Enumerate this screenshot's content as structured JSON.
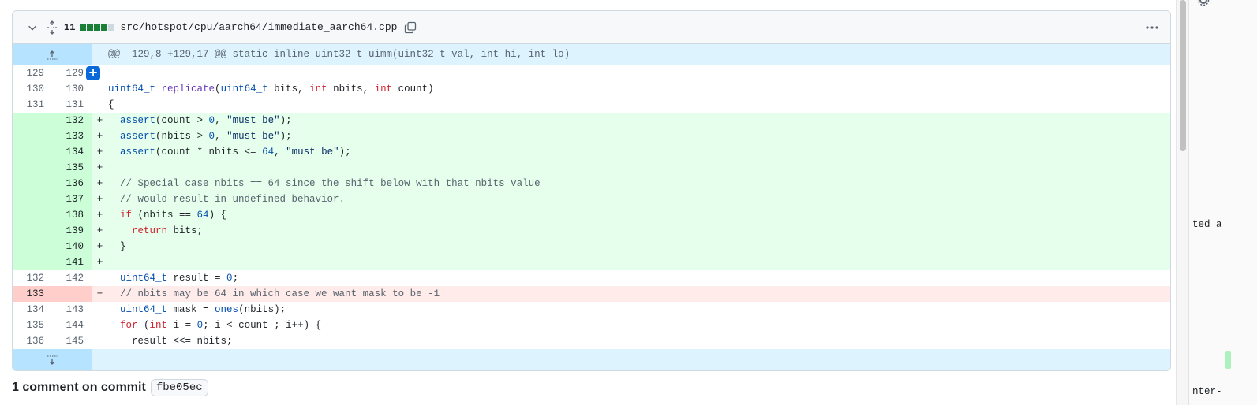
{
  "file": {
    "diffstat_count": "11",
    "diffstat_colors": [
      "#1a7f37",
      "#1a7f37",
      "#1a7f37",
      "#1a7f37",
      "#d1d9e0"
    ],
    "path": "src/hotspot/cpu/aarch64/immediate_aarch64.cpp",
    "icons": {
      "collapse": "chevron-down-icon",
      "expand_all": "unfold-icon",
      "copy": "copy-icon",
      "more": "kebab-horizontal-icon"
    }
  },
  "diff": {
    "hunk_header": "@@ -129,8 +129,17 @@ static inline uint32_t uimm(uint32_t val, int hi, int lo)",
    "lines": [
      {
        "type": "ctx",
        "old": "129",
        "new": "129",
        "sign": "",
        "tokens": [],
        "has_add_button": true
      },
      {
        "type": "ctx",
        "old": "130",
        "new": "130",
        "sign": "",
        "tokens": [
          {
            "t": "uint64_t",
            "c": "type"
          },
          {
            "t": " ",
            "c": "plain"
          },
          {
            "t": "replicate",
            "c": "fn"
          },
          {
            "t": "(",
            "c": "plain"
          },
          {
            "t": "uint64_t",
            "c": "type"
          },
          {
            "t": " bits, ",
            "c": "plain"
          },
          {
            "t": "int",
            "c": "kw"
          },
          {
            "t": " nbits, ",
            "c": "plain"
          },
          {
            "t": "int",
            "c": "kw"
          },
          {
            "t": " count)",
            "c": "plain"
          }
        ]
      },
      {
        "type": "ctx",
        "old": "131",
        "new": "131",
        "sign": "",
        "tokens": [
          {
            "t": "{",
            "c": "plain"
          }
        ]
      },
      {
        "type": "add",
        "old": "",
        "new": "132",
        "sign": "+",
        "tokens": [
          {
            "t": "  ",
            "c": "plain"
          },
          {
            "t": "assert",
            "c": "type"
          },
          {
            "t": "(count > ",
            "c": "plain"
          },
          {
            "t": "0",
            "c": "num"
          },
          {
            "t": ", ",
            "c": "plain"
          },
          {
            "t": "\"must be\"",
            "c": "str"
          },
          {
            "t": ");",
            "c": "plain"
          }
        ]
      },
      {
        "type": "add",
        "old": "",
        "new": "133",
        "sign": "+",
        "tokens": [
          {
            "t": "  ",
            "c": "plain"
          },
          {
            "t": "assert",
            "c": "type"
          },
          {
            "t": "(nbits > ",
            "c": "plain"
          },
          {
            "t": "0",
            "c": "num"
          },
          {
            "t": ", ",
            "c": "plain"
          },
          {
            "t": "\"must be\"",
            "c": "str"
          },
          {
            "t": ");",
            "c": "plain"
          }
        ]
      },
      {
        "type": "add",
        "old": "",
        "new": "134",
        "sign": "+",
        "tokens": [
          {
            "t": "  ",
            "c": "plain"
          },
          {
            "t": "assert",
            "c": "type"
          },
          {
            "t": "(count * nbits <= ",
            "c": "plain"
          },
          {
            "t": "64",
            "c": "num"
          },
          {
            "t": ", ",
            "c": "plain"
          },
          {
            "t": "\"must be\"",
            "c": "str"
          },
          {
            "t": ");",
            "c": "plain"
          }
        ]
      },
      {
        "type": "add",
        "old": "",
        "new": "135",
        "sign": "+",
        "tokens": []
      },
      {
        "type": "add",
        "old": "",
        "new": "136",
        "sign": "+",
        "tokens": [
          {
            "t": "  ",
            "c": "plain"
          },
          {
            "t": "// Special case nbits == 64 since the shift below with that nbits value",
            "c": "cmt"
          }
        ]
      },
      {
        "type": "add",
        "old": "",
        "new": "137",
        "sign": "+",
        "tokens": [
          {
            "t": "  ",
            "c": "plain"
          },
          {
            "t": "// would result in undefined behavior.",
            "c": "cmt"
          }
        ]
      },
      {
        "type": "add",
        "old": "",
        "new": "138",
        "sign": "+",
        "tokens": [
          {
            "t": "  ",
            "c": "plain"
          },
          {
            "t": "if",
            "c": "kw"
          },
          {
            "t": " (nbits == ",
            "c": "plain"
          },
          {
            "t": "64",
            "c": "num"
          },
          {
            "t": ") {",
            "c": "plain"
          }
        ]
      },
      {
        "type": "add",
        "old": "",
        "new": "139",
        "sign": "+",
        "tokens": [
          {
            "t": "    ",
            "c": "plain"
          },
          {
            "t": "return",
            "c": "kw"
          },
          {
            "t": " bits;",
            "c": "plain"
          }
        ]
      },
      {
        "type": "add",
        "old": "",
        "new": "140",
        "sign": "+",
        "tokens": [
          {
            "t": "  }",
            "c": "plain"
          }
        ]
      },
      {
        "type": "add",
        "old": "",
        "new": "141",
        "sign": "+",
        "tokens": []
      },
      {
        "type": "ctx",
        "old": "132",
        "new": "142",
        "sign": "",
        "tokens": [
          {
            "t": "  ",
            "c": "plain"
          },
          {
            "t": "uint64_t",
            "c": "type"
          },
          {
            "t": " result = ",
            "c": "plain"
          },
          {
            "t": "0",
            "c": "num"
          },
          {
            "t": ";",
            "c": "plain"
          }
        ]
      },
      {
        "type": "del",
        "old": "133",
        "new": "",
        "sign": "−",
        "tokens": [
          {
            "t": "  ",
            "c": "plain"
          },
          {
            "t": "// nbits may be 64 in which case we want mask to be -1",
            "c": "cmt"
          }
        ]
      },
      {
        "type": "ctx",
        "old": "134",
        "new": "143",
        "sign": "",
        "tokens": [
          {
            "t": "  ",
            "c": "plain"
          },
          {
            "t": "uint64_t",
            "c": "type"
          },
          {
            "t": " mask = ",
            "c": "plain"
          },
          {
            "t": "ones",
            "c": "type"
          },
          {
            "t": "(nbits);",
            "c": "plain"
          }
        ]
      },
      {
        "type": "ctx",
        "old": "135",
        "new": "144",
        "sign": "",
        "tokens": [
          {
            "t": "  ",
            "c": "plain"
          },
          {
            "t": "for",
            "c": "kw"
          },
          {
            "t": " (",
            "c": "plain"
          },
          {
            "t": "int",
            "c": "kw"
          },
          {
            "t": " i = ",
            "c": "plain"
          },
          {
            "t": "0",
            "c": "num"
          },
          {
            "t": "; i < count ; i++) {",
            "c": "plain"
          }
        ]
      },
      {
        "type": "ctx",
        "old": "136",
        "new": "145",
        "sign": "",
        "tokens": [
          {
            "t": "    result <<= nbits;",
            "c": "plain"
          }
        ]
      }
    ]
  },
  "comments": {
    "title": "1 comment on commit",
    "sha": "fbe05ec"
  },
  "side_panel": {
    "snippet_1": "ted a",
    "snippet_2": "nter-"
  }
}
